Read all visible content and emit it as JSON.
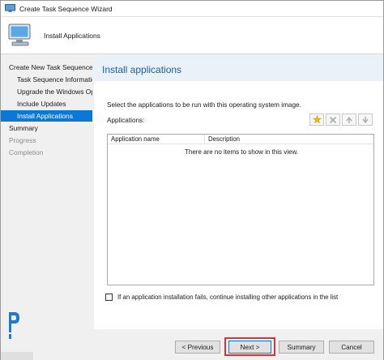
{
  "window": {
    "title": "Create Task Sequence Wizard"
  },
  "header": {
    "title": "Install Applications"
  },
  "nav": {
    "items": [
      {
        "label": "Create New Task Sequence",
        "level": 0,
        "state": "normal"
      },
      {
        "label": "Task Sequence Information",
        "level": 1,
        "state": "normal"
      },
      {
        "label": "Upgrade the Windows Operating System",
        "level": 1,
        "state": "normal"
      },
      {
        "label": "Include Updates",
        "level": 1,
        "state": "normal"
      },
      {
        "label": "Install Applications",
        "level": 1,
        "state": "selected"
      },
      {
        "label": "Summary",
        "level": 0,
        "state": "normal"
      },
      {
        "label": "Progress",
        "level": 0,
        "state": "disabled"
      },
      {
        "label": "Completion",
        "level": 0,
        "state": "disabled"
      }
    ]
  },
  "content": {
    "heading": "Install applications",
    "instructions": "Select the applications to be run with this operating system image.",
    "applications_label": "Applications:",
    "toolbar": [
      {
        "icon": "new-star-icon"
      },
      {
        "icon": "delete-x-icon"
      },
      {
        "icon": "move-up-icon"
      },
      {
        "icon": "move-down-icon"
      }
    ],
    "list": {
      "columns": [
        "Application name",
        "Description"
      ],
      "empty_message": "There are no items to show in this view."
    },
    "continue_option": {
      "label": "If an application installation fails, continue installing other applications in the list",
      "checked": false
    }
  },
  "buttons": {
    "previous": "< Previous",
    "next": "Next >",
    "summary": "Summary",
    "cancel": "Cancel"
  },
  "colors": {
    "selection": "#0a78d4",
    "heading": "#1f5c9e",
    "highlight_frame": "#d4343a"
  }
}
